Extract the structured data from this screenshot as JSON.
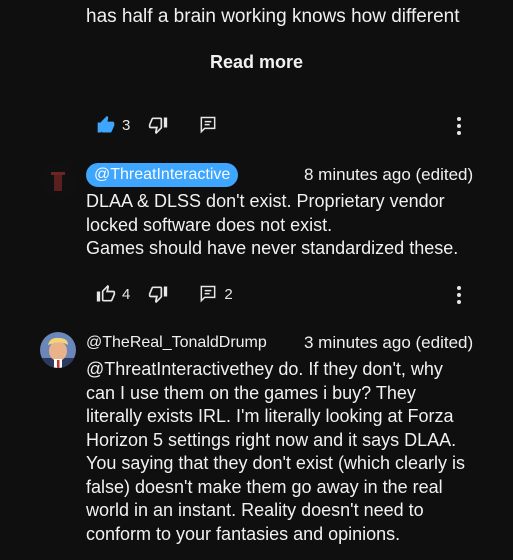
{
  "previous_comment": {
    "clipped_line": "has half a brain working knows how different",
    "read_more_label": "Read more",
    "like_count": "3"
  },
  "comment1": {
    "author": "@ThreatInteractive",
    "timestamp": "8 minutes ago (edited)",
    "lines": [
      "DLAA & DLSS don't exist. Proprietary vendor",
      "locked software does not exist.",
      "Games should have never standardized these."
    ],
    "like_count": "4",
    "reply_count": "2"
  },
  "comment2": {
    "author": "@TheReal_TonaldDrump",
    "timestamp": "3 minutes ago (edited)",
    "lines": [
      "@ThreatInteractivethey do. If they don't, why",
      "can I use them on the games i buy? They",
      "literally exists IRL. I'm literally looking at Forza",
      "Horizon 5 settings right now and it says DLAA.",
      "You saying that they don't exist (which clearly is",
      "false) doesn't make them go away in the real",
      "world in an instant. Reality doesn't need to",
      "conform to your fantasies and opinions."
    ]
  },
  "icons": {
    "like": "thumbs-up-icon",
    "dislike": "thumbs-down-icon",
    "reply": "reply-comment-icon",
    "more": "more-vertical-icon"
  },
  "colors": {
    "background": "#0f0f0f",
    "text": "#f1f1f1",
    "like_active": "#3ea6ff",
    "author_chip": "#3ea6ff"
  }
}
